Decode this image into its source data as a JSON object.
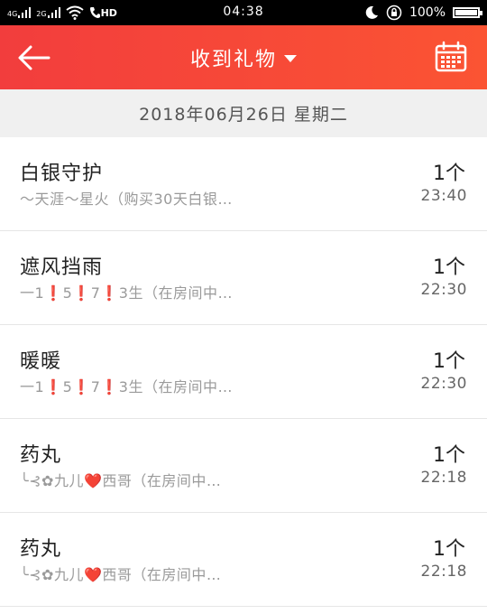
{
  "status_bar": {
    "net_1": "4G",
    "net_2": "2G",
    "hd": "HD",
    "time": "04:38",
    "battery_text": "100%",
    "battery_level": 1.0
  },
  "header": {
    "title": "收到礼物",
    "back_icon": "arrow-left-icon",
    "calendar_icon": "calendar-icon",
    "accent": "#f5423a"
  },
  "date_bar": {
    "text": "2018年06月26日 星期二"
  },
  "gifts": [
    {
      "name": "白银守护",
      "sender": "〜天涯〜星火（购买30天白银…",
      "count": "1个",
      "time": "23:40"
    },
    {
      "name": "遮风挡雨",
      "sender": "一1❗5❗7❗3生（在房间中…",
      "count": "1个",
      "time": "22:30"
    },
    {
      "name": "暖暖",
      "sender": "一1❗5❗7❗3生（在房间中…",
      "count": "1个",
      "time": "22:30"
    },
    {
      "name": "药丸",
      "sender": "╰⊰✿九儿❤️西哥（在房间中…",
      "count": "1个",
      "time": "22:18"
    },
    {
      "name": "药丸",
      "sender": "╰⊰✿九儿❤️西哥（在房间中…",
      "count": "1个",
      "time": "22:18"
    }
  ]
}
